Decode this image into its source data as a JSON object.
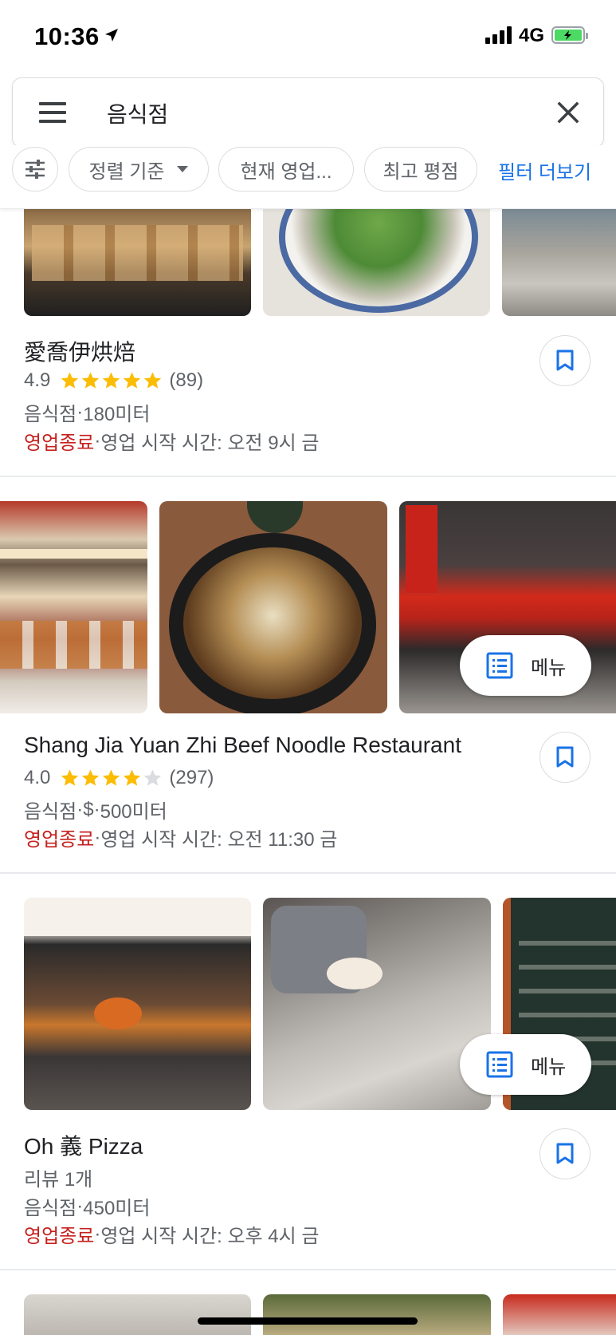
{
  "status_bar": {
    "time": "10:36",
    "network": "4G"
  },
  "search": {
    "query": "음식점"
  },
  "filters": {
    "sort": "정렬 기준",
    "open_now": "현재 영업...",
    "top_rated": "최고 평점",
    "more": "필터 더보기"
  },
  "results": [
    {
      "name": "愛喬伊烘焙",
      "rating": "4.9",
      "stars": 5,
      "reviews": "(89)",
      "category": "음식점",
      "distance": "180미터",
      "status": "영업종료",
      "hours": "영업 시작 시간: 오전 9시 금"
    },
    {
      "name": "Shang Jia Yuan Zhi Beef Noodle Restaurant",
      "rating": "4.0",
      "stars": 4,
      "reviews": "(297)",
      "category": "음식점",
      "price": "$",
      "distance": "500미터",
      "status": "영업종료",
      "hours": "영업 시작 시간: 오전 11:30 금",
      "menu_label": "메뉴"
    },
    {
      "name": "Oh 義 Pizza",
      "review_count_text": "리뷰 1개",
      "category": "음식점",
      "distance": "450미터",
      "status": "영업종료",
      "hours": "영업 시작 시간: 오후 4시 금",
      "menu_label": "메뉴"
    }
  ],
  "sep": " · ",
  "colors": {
    "accent": "#1a73e8",
    "closed": "#c5221f",
    "star": "#fbbc04",
    "text_secondary": "#5f6368"
  }
}
